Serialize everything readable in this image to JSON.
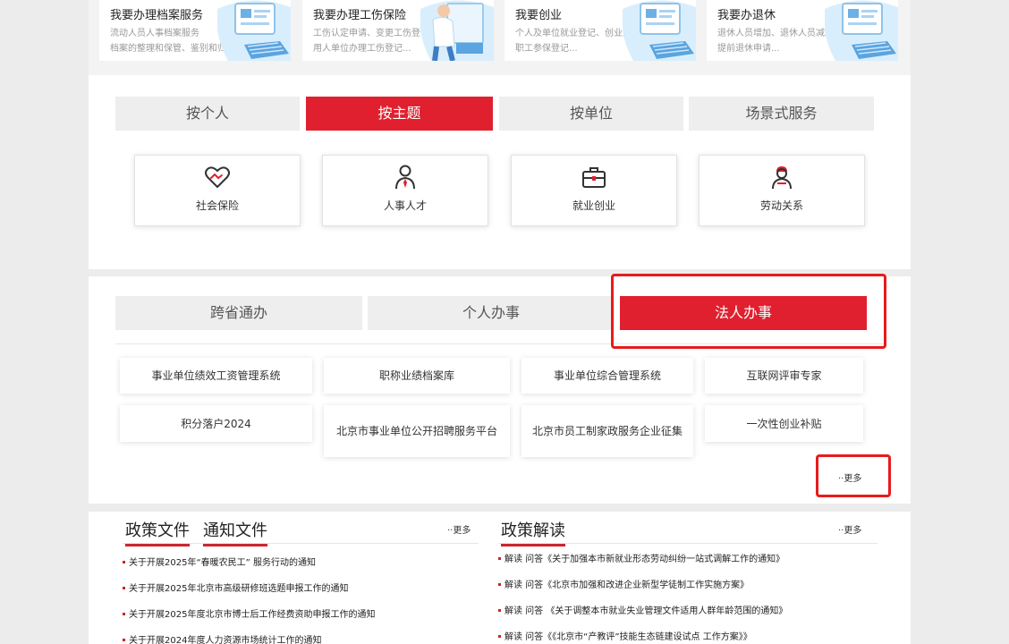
{
  "service_cards": [
    {
      "title": "我要办理档案服务",
      "desc1": "流动人员人事档案服务",
      "desc2": "档案的整理和保管、鉴别和归档..."
    },
    {
      "title": "我要办理工伤保险",
      "desc1": "工伤认定申请、变更工伤登记",
      "desc2": "用人单位办理工伤登记..."
    },
    {
      "title": "我要创业",
      "desc1": "个人及单位就业登记、创业开业指导",
      "desc2": "职工参保登记..."
    },
    {
      "title": "我要办退休",
      "desc1": "退休人员增加、退休人员减少",
      "desc2": "提前退休申请..."
    }
  ],
  "category_tabs": [
    "按个人",
    "按主题",
    "按单位",
    "场景式服务"
  ],
  "active_category": "按主题",
  "themes": [
    {
      "label": "社会保险",
      "icon": "heart-hand-icon"
    },
    {
      "label": "人事人才",
      "icon": "person-tie-icon"
    },
    {
      "label": "就业创业",
      "icon": "briefcase-icon"
    },
    {
      "label": "劳动关系",
      "icon": "worker-icon"
    }
  ],
  "service_tabs": [
    "跨省通办",
    "个人办事",
    "法人办事"
  ],
  "active_service_tab": "法人办事",
  "service_links": [
    "事业单位绩效工资管理系统",
    "职称业绩档案库",
    "事业单位综合管理系统",
    "互联网评审专家",
    "积分落户2024",
    "北京市事业单位公开招聘服务平台",
    "北京市员工制家政服务企业征集",
    "一次性创业补贴"
  ],
  "more_label": "··更多",
  "policy": {
    "tab1": "政策文件",
    "tab2": "通知文件",
    "more": "··更多",
    "items": [
      "关于开展2025年“春暖农民工” 服务行动的通知",
      "关于开展2025年北京市高级研修班选题申报工作的通知",
      "关于开展2025年度北京市博士后工作经费资助申报工作的通知",
      "关于开展2024年度人力资源市场统计工作的通知"
    ]
  },
  "interpretation": {
    "title": "政策解读",
    "more": "··更多",
    "items": [
      "解读 问答《关于加强本市新就业形态劳动纠纷一站式调解工作的通知》",
      "解读 问答《北京市加强和改进企业新型学徒制工作实施方案》",
      "解读 问答 《关于调整本市就业失业管理文件适用人群年龄范围的通知》",
      "解读 问答《《北京市“产教评”技能生态链建设试点 工作方案》》"
    ]
  },
  "colors": {
    "accent": "#e0202f",
    "highlight": "#e81b1b"
  }
}
